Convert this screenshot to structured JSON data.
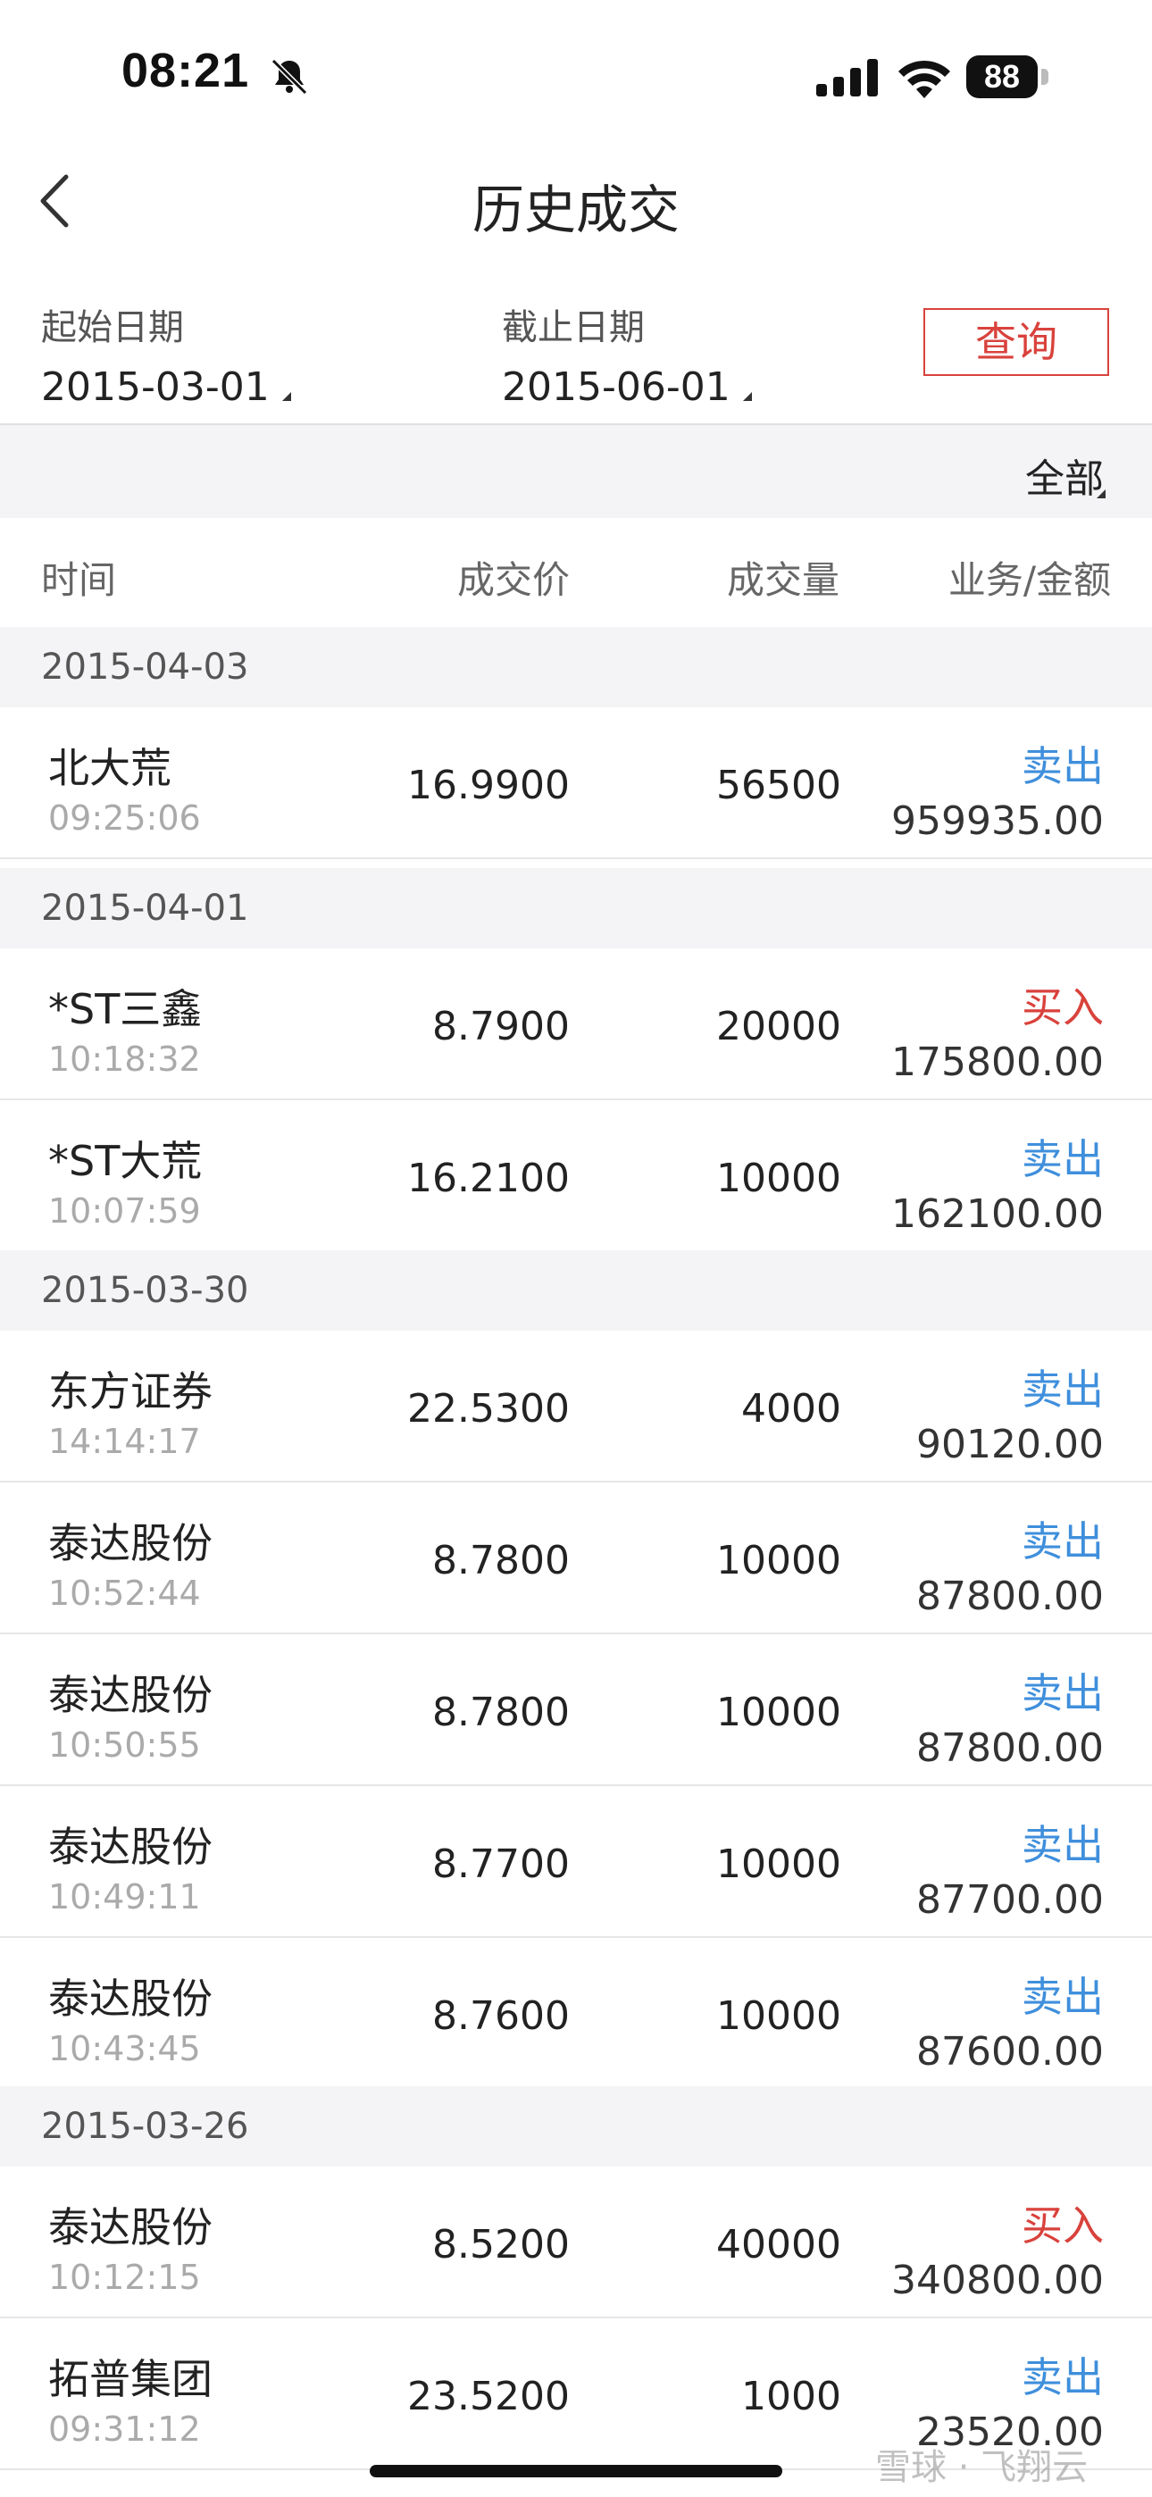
{
  "status": {
    "time": "08:21",
    "battery": "88"
  },
  "nav": {
    "title": "历史成交"
  },
  "filter": {
    "start_label": "起始日期",
    "start_value": "2015-03-01",
    "end_label": "截止日期",
    "end_value": "2015-06-01",
    "query_label": "查询",
    "scope": "全部"
  },
  "columns": {
    "time": "时间",
    "price": "成交价",
    "volume": "成交量",
    "action_amount": "业务/金额"
  },
  "colors": {
    "sell": "#3f8fdc",
    "buy": "#d9423c",
    "accent": "#d9423c"
  },
  "groups": [
    {
      "date": "2015-04-03",
      "rows": [
        {
          "name": "北大荒",
          "time": "09:25:06",
          "price": "16.9900",
          "volume": "56500",
          "action": "卖出",
          "type": "sell",
          "amount": "959935.00"
        }
      ]
    },
    {
      "date": "2015-04-01",
      "rows": [
        {
          "name": "*ST三鑫",
          "time": "10:18:32",
          "price": "8.7900",
          "volume": "20000",
          "action": "买入",
          "type": "buy",
          "amount": "175800.00"
        },
        {
          "name": "*ST大荒",
          "time": "10:07:59",
          "price": "16.2100",
          "volume": "10000",
          "action": "卖出",
          "type": "sell",
          "amount": "162100.00"
        }
      ]
    },
    {
      "date": "2015-03-30",
      "rows": [
        {
          "name": "东方证券",
          "time": "14:14:17",
          "price": "22.5300",
          "volume": "4000",
          "action": "卖出",
          "type": "sell",
          "amount": "90120.00"
        },
        {
          "name": "泰达股份",
          "time": "10:52:44",
          "price": "8.7800",
          "volume": "10000",
          "action": "卖出",
          "type": "sell",
          "amount": "87800.00"
        },
        {
          "name": "泰达股份",
          "time": "10:50:55",
          "price": "8.7800",
          "volume": "10000",
          "action": "卖出",
          "type": "sell",
          "amount": "87800.00"
        },
        {
          "name": "泰达股份",
          "time": "10:49:11",
          "price": "8.7700",
          "volume": "10000",
          "action": "卖出",
          "type": "sell",
          "amount": "87700.00"
        },
        {
          "name": "泰达股份",
          "time": "10:43:45",
          "price": "8.7600",
          "volume": "10000",
          "action": "卖出",
          "type": "sell",
          "amount": "87600.00"
        }
      ]
    },
    {
      "date": "2015-03-26",
      "rows": [
        {
          "name": "泰达股份",
          "time": "10:12:15",
          "price": "8.5200",
          "volume": "40000",
          "action": "买入",
          "type": "buy",
          "amount": "340800.00"
        },
        {
          "name": "拓普集团",
          "time": "09:31:12",
          "price": "23.5200",
          "volume": "1000",
          "action": "卖出",
          "type": "sell",
          "amount": "23520.00"
        }
      ]
    }
  ],
  "watermark": "雪球 · 飞翔云"
}
